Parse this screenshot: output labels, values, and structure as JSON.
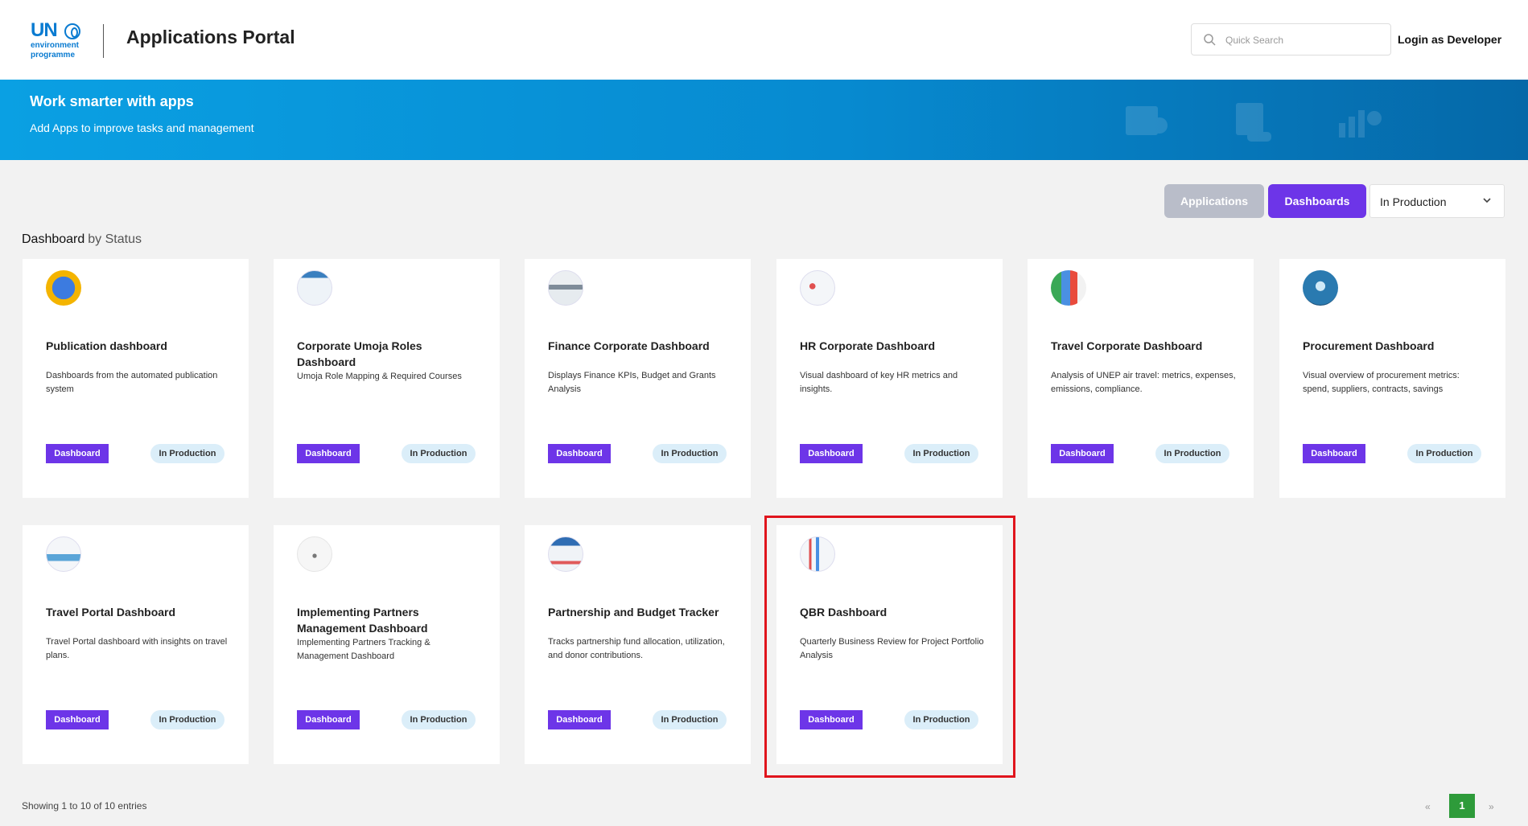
{
  "header": {
    "logo_un": "UN",
    "logo_sub_1": "environment",
    "logo_sub_2": "programme",
    "title": "Applications Portal",
    "search_placeholder": "Quick Search",
    "login_label": "Login as Developer"
  },
  "banner": {
    "heading": "Work smarter with apps",
    "subheading": "Add Apps to improve tasks and management"
  },
  "toolbar": {
    "applications_label": "Applications",
    "dashboards_label": "Dashboards",
    "status_selected": "In Production"
  },
  "section": {
    "title": "Dashboard",
    "subtitle": "by Status"
  },
  "cards": [
    {
      "title": "Publication dashboard",
      "description": "Dashboards from the automated publication system",
      "type": "Dashboard",
      "status": "In Production",
      "icon": "publication-icon"
    },
    {
      "title": "Corporate Umoja Roles Dashboard",
      "description": "Umoja Role Mapping & Required Courses",
      "type": "Dashboard",
      "status": "In Production",
      "icon": "umoja-roles-icon"
    },
    {
      "title": "Finance Corporate Dashboard",
      "description": "Displays Finance KPIs, Budget and Grants Analysis",
      "type": "Dashboard",
      "status": "In Production",
      "icon": "finance-icon"
    },
    {
      "title": "HR Corporate Dashboard",
      "description": "Visual dashboard of key HR metrics and insights.",
      "type": "Dashboard",
      "status": "In Production",
      "icon": "hr-icon"
    },
    {
      "title": "Travel Corporate Dashboard",
      "description": "Analysis of UNEP air travel: metrics, expenses, emissions, compliance.",
      "type": "Dashboard",
      "status": "In Production",
      "icon": "travel-corporate-icon"
    },
    {
      "title": "Procurement Dashboard",
      "description": "Visual overview of procurement metrics: spend, suppliers, contracts, savings",
      "type": "Dashboard",
      "status": "In Production",
      "icon": "procurement-icon"
    },
    {
      "title": "Travel Portal Dashboard",
      "description": "Travel Portal dashboard with insights on travel plans.",
      "type": "Dashboard",
      "status": "In Production",
      "icon": "travel-portal-icon"
    },
    {
      "title": "Implementing Partners Management Dashboard",
      "description": "Implementing Partners Tracking & Management Dashboard",
      "type": "Dashboard",
      "status": "In Production",
      "icon": "partners-icon"
    },
    {
      "title": "Partnership and Budget Tracker",
      "description": "Tracks partnership fund allocation, utilization, and donor contributions.",
      "type": "Dashboard",
      "status": "In Production",
      "icon": "budget-tracker-icon"
    },
    {
      "title": "QBR Dashboard",
      "description": "Quarterly Business Review for Project Portfolio Analysis",
      "type": "Dashboard",
      "status": "In Production",
      "icon": "qbr-icon"
    }
  ],
  "footer": {
    "entries_text": "Showing 1 to 10 of 10 entries",
    "prev_label": "«",
    "current_page": "1",
    "next_label": "»"
  },
  "colors": {
    "accent_purple": "#6d35e8",
    "banner_blue": "#078ad0",
    "pager_green": "#2e9b3a",
    "highlight_red": "#e0151d"
  }
}
